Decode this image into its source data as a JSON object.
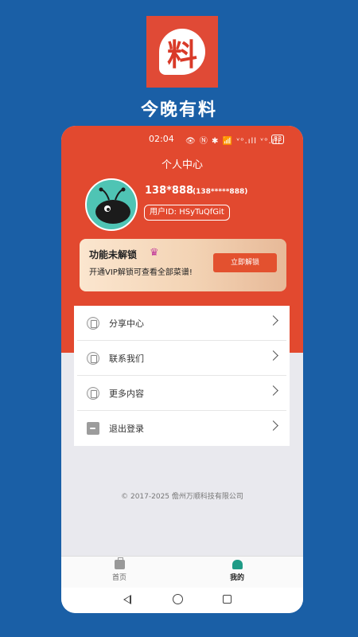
{
  "app": {
    "logo_glyph": "料",
    "title": "今晚有料"
  },
  "status_bar": {
    "time": "02:04",
    "icons": "👁 Ⓝ ✱ 📶 ᵛᵒ.ıll ᵛᵒ.ıll",
    "battery": "83"
  },
  "header": {
    "title": "个人中心"
  },
  "profile": {
    "username": "138*888",
    "username_sub": "(138*****888)",
    "user_id_label": "用户ID:  HSyTuQfGit"
  },
  "vip": {
    "title": "功能未解锁",
    "description": "开通VIP解锁可查看全部菜谱!",
    "button_label": "立即解锁",
    "crown": "♛"
  },
  "menu": {
    "items": [
      {
        "label": "分享中心",
        "icon": "clipboard-icon"
      },
      {
        "label": "联系我们",
        "icon": "clipboard-icon"
      },
      {
        "label": "更多内容",
        "icon": "clipboard-icon"
      },
      {
        "label": "退出登录",
        "icon": "logout-icon"
      }
    ]
  },
  "footer": {
    "copyright": "© 2017-2025 儋州万顺科技有限公司"
  },
  "tabbar": {
    "home_label": "首页",
    "me_label": "我的"
  },
  "colors": {
    "background": "#1a5fa6",
    "accent": "#e2492f",
    "vip_button": "#e3512f",
    "avatar": "#4fc4b4"
  }
}
